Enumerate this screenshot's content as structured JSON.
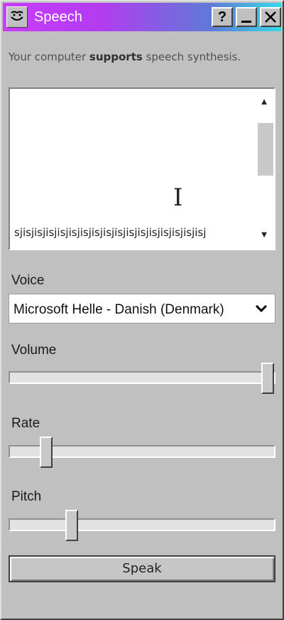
{
  "window": {
    "title": "Speech",
    "help_label": "?"
  },
  "support_message": {
    "prefix": "Your computer ",
    "emphasis": "supports",
    "suffix": " speech synthesis."
  },
  "text_input": {
    "value": "sjisjisjisjisjisjisjisjisjisjisjisjisjisjisjisjisj"
  },
  "voice": {
    "label": "Voice",
    "selected": "Microsoft Helle - Danish (Denmark)"
  },
  "volume": {
    "label": "Volume",
    "level": 1.0
  },
  "rate": {
    "label": "Rate",
    "level": 0.12
  },
  "pitch": {
    "label": "Pitch",
    "level": 0.22
  },
  "speak_button": {
    "label": "Speak"
  }
}
